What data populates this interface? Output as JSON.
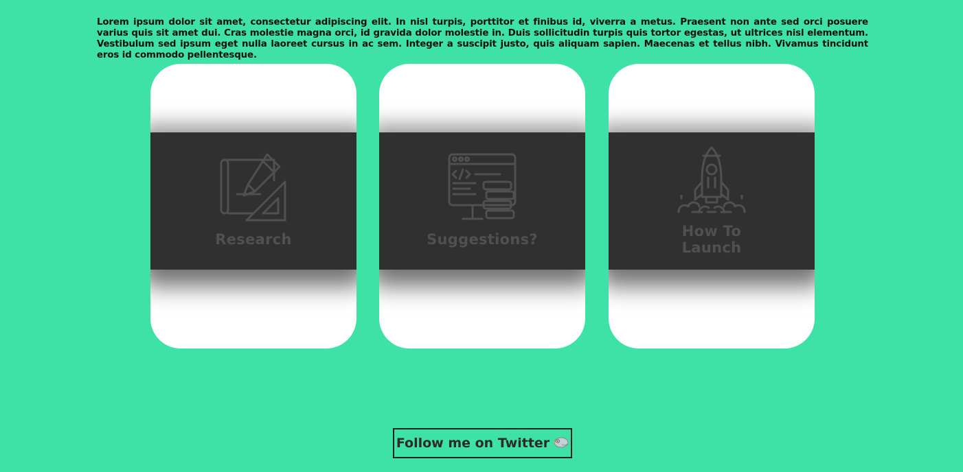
{
  "intro": {
    "text": "Lorem ipsum dolor sit amet, consectetur adipiscing elit. In nisl turpis, porttitor et finibus id, viverra a metus. Praesent non ante sed orci posuere varius quis sit amet dui. Cras molestie magna orci, id gravida dolor molestie in. Duis sollicitudin turpis quis tortor egestas, ut ultrices nisl elementum. Vestibulum sed ipsum eget nulla laoreet cursus in ac sem. Integer a suscipit justo, quis aliquam sapien. Maecenas et tellus nibh. Vivamus tincidunt eros id commodo pellentesque."
  },
  "cards": [
    {
      "title": "Research",
      "icon": "blueprint-pencil-icon"
    },
    {
      "title": "Suggestions?",
      "icon": "code-monitor-icon"
    },
    {
      "title_line1": "How To",
      "title_line2": "Launch",
      "icon": "rocket-icon"
    }
  ],
  "footer": {
    "button_label": "Follow me on Twitter",
    "icon": "bird-icon"
  },
  "colors": {
    "background": "#3ee1a6",
    "card": "#ffffff",
    "band": "#303030",
    "icon": "#505050"
  }
}
